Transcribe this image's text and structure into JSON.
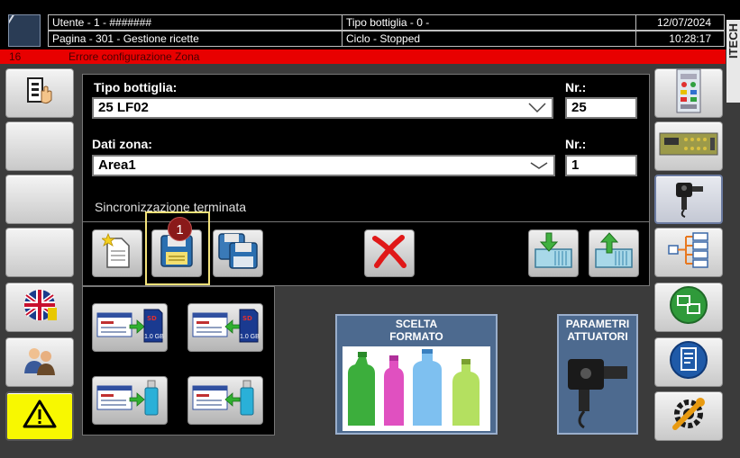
{
  "header": {
    "user": "Utente - 1 - #######",
    "page": "Pagina - 301 - Gestione ricette",
    "bottle_type": "Tipo bottiglia - 0 -",
    "cycle": "Ciclo - Stopped",
    "date": "12/07/2024",
    "time": "10:28:17"
  },
  "error": {
    "code": "16",
    "message": "Errore configurazione Zona"
  },
  "recipe": {
    "bottle_label": "Tipo bottiglia:",
    "bottle_value": "25 LF02",
    "bottle_nr_label": "Nr.:",
    "bottle_nr": "25",
    "zone_label": "Dati zona:",
    "zone_value": "Area1",
    "zone_nr_label": "Nr.:",
    "zone_nr": "1",
    "status": "Sincronizzazione terminata"
  },
  "highlight_badge": "1",
  "usb_sizes": [
    "1.0 GB",
    "1.0 GB"
  ],
  "big_buttons": {
    "format": "SCELTA\nFORMATO",
    "actuators": "PARAMETRI\nATTUATORI"
  },
  "colors": {
    "error_bar": "#e80000",
    "warning_button": "#f8f800",
    "highlight": "#f2e27a",
    "badge": "#8a1a1a"
  },
  "icons": {
    "left": [
      "recipe-hand-icon",
      "",
      "",
      "",
      "uk-flag-icon",
      "users-icon",
      "warning-icon"
    ],
    "right": [
      "control-panel-icon",
      "pcb-board-icon",
      "actuator-icon",
      "tree-structure-icon",
      "network-icon",
      "document-icon",
      "settings-wrench-icon"
    ]
  }
}
